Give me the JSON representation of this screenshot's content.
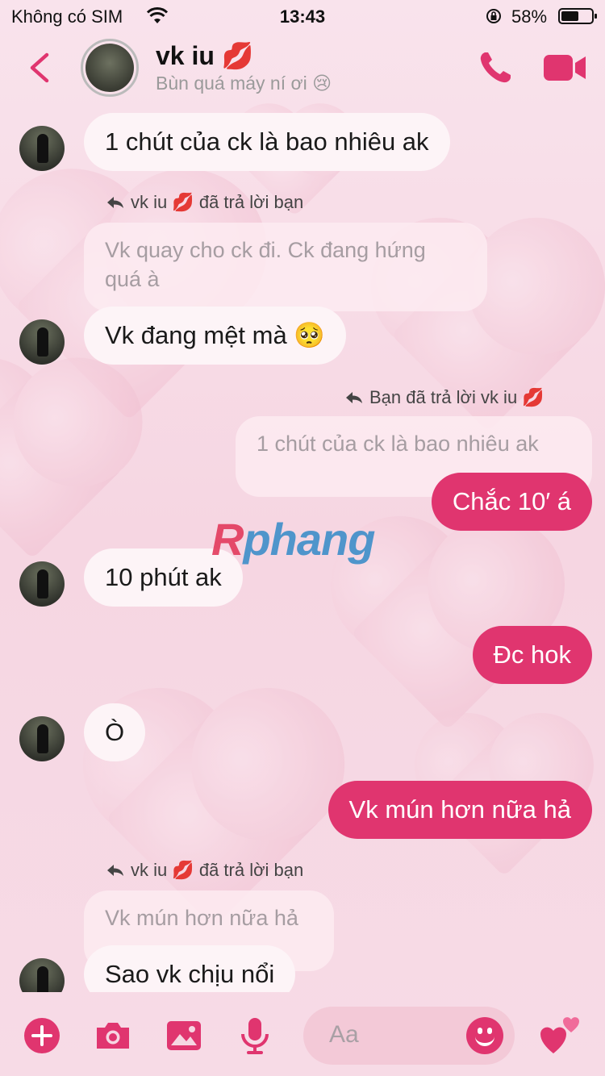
{
  "status_bar": {
    "carrier": "Không có SIM",
    "time": "13:43",
    "battery_pct": "58%",
    "battery_level": 0.58
  },
  "header": {
    "name": "vk iu 💋",
    "status": "Bùn quá máy ní ơi 😢"
  },
  "messages": [
    {
      "id": "m1",
      "type": "incoming",
      "text": "1 chút của ck là bao nhiêu ak"
    },
    {
      "id": "m2",
      "type": "reply-label-in",
      "text": "vk iu 💋  đã trả lời bạn"
    },
    {
      "id": "m3",
      "type": "quoted",
      "text": "Vk quay cho ck đi. Ck đang hứng quá à"
    },
    {
      "id": "m4",
      "type": "incoming",
      "text": "Vk đang mệt mà 🥺"
    },
    {
      "id": "m5",
      "type": "reply-label-out",
      "text": "Bạn đã trả lời vk iu 💋"
    },
    {
      "id": "m6",
      "type": "quoted",
      "text": "1 chút của ck là bao nhiêu ak"
    },
    {
      "id": "m7",
      "type": "outgoing",
      "text": "Chắc 10′ á"
    },
    {
      "id": "m8",
      "type": "incoming",
      "text": "10 phút ak"
    },
    {
      "id": "m9",
      "type": "outgoing",
      "text": "Đc hok"
    },
    {
      "id": "m10",
      "type": "incoming",
      "text": "Ò"
    },
    {
      "id": "m11",
      "type": "outgoing",
      "text": "Vk mún hơn nữa hả"
    },
    {
      "id": "m12",
      "type": "reply-label-in",
      "text": "vk iu 💋  đã trả lời bạn"
    },
    {
      "id": "m13",
      "type": "quoted",
      "text": "Vk mún hơn nữa hả"
    },
    {
      "id": "m14",
      "type": "incoming",
      "text": "Sao vk chịu nổi"
    }
  ],
  "watermark": {
    "r": "R",
    "rest": "phang"
  },
  "composer": {
    "placeholder": "Aa"
  },
  "icons": [
    "back-chevron-icon",
    "phone-icon",
    "video-camera-icon",
    "plus-icon",
    "camera-icon",
    "image-icon",
    "microphone-icon",
    "smiley-icon",
    "hearts-icon",
    "reply-arrow-icon"
  ],
  "colors": {
    "accent": "#e0356f",
    "incoming_bubble": "#fdf4f7",
    "background": "#f7dfe8"
  }
}
